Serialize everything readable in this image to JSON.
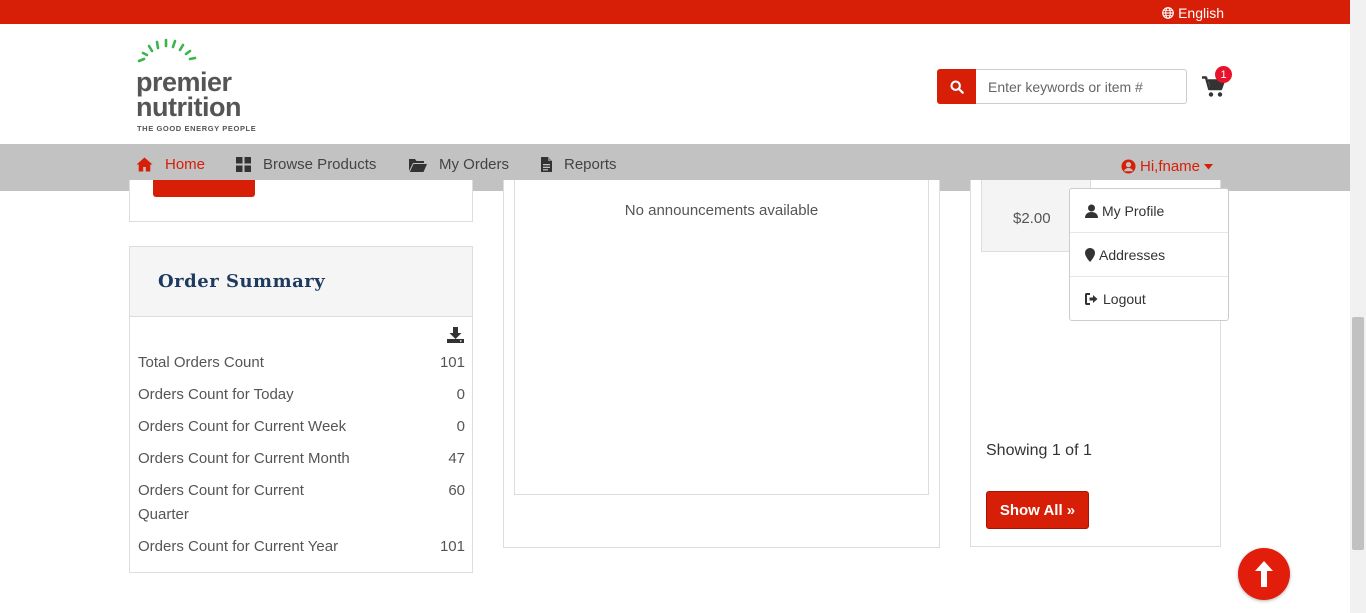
{
  "topbar": {
    "language": "English"
  },
  "brand": {
    "line1": "premier",
    "line2": "nutrition",
    "tagline": "THE GOOD ENERGY PEOPLE"
  },
  "search": {
    "placeholder": "Enter keywords or item #"
  },
  "cart": {
    "count": "1"
  },
  "nav": {
    "items": [
      {
        "label": "Home",
        "icon": "home-icon"
      },
      {
        "label": "Browse Products",
        "icon": "grid-icon"
      },
      {
        "label": "My Orders",
        "icon": "folder-open-icon"
      },
      {
        "label": "Reports",
        "icon": "file-text-icon"
      }
    ],
    "user": "Hi,fname"
  },
  "user_menu": {
    "items": [
      {
        "label": "My Profile",
        "icon": "user-icon"
      },
      {
        "label": "Addresses",
        "icon": "map-marker-icon"
      },
      {
        "label": "Logout",
        "icon": "sign-out-icon"
      }
    ]
  },
  "order_summary": {
    "title": "Order Summary",
    "rows": [
      {
        "label": "Total Orders Count",
        "value": "101"
      },
      {
        "label": "Orders Count for Today",
        "value": "0"
      },
      {
        "label": "Orders Count for Current Week",
        "value": "0"
      },
      {
        "label": "Orders Count for Current Month",
        "value": "47"
      },
      {
        "label": "Orders Count for Current Quarter",
        "value": "60"
      },
      {
        "label": "Orders Count for Current Year",
        "value": "101"
      }
    ]
  },
  "announcements": {
    "empty_text": "No announcements available"
  },
  "products": {
    "price": "$2.00",
    "showing": "Showing 1 of 1",
    "show_all": "Show All »"
  },
  "colors": {
    "brand_red": "#d71e06",
    "nav_gray": "#c2c2c2",
    "title_navy": "#1e3a5f",
    "logo_green": "#3bb54a"
  }
}
